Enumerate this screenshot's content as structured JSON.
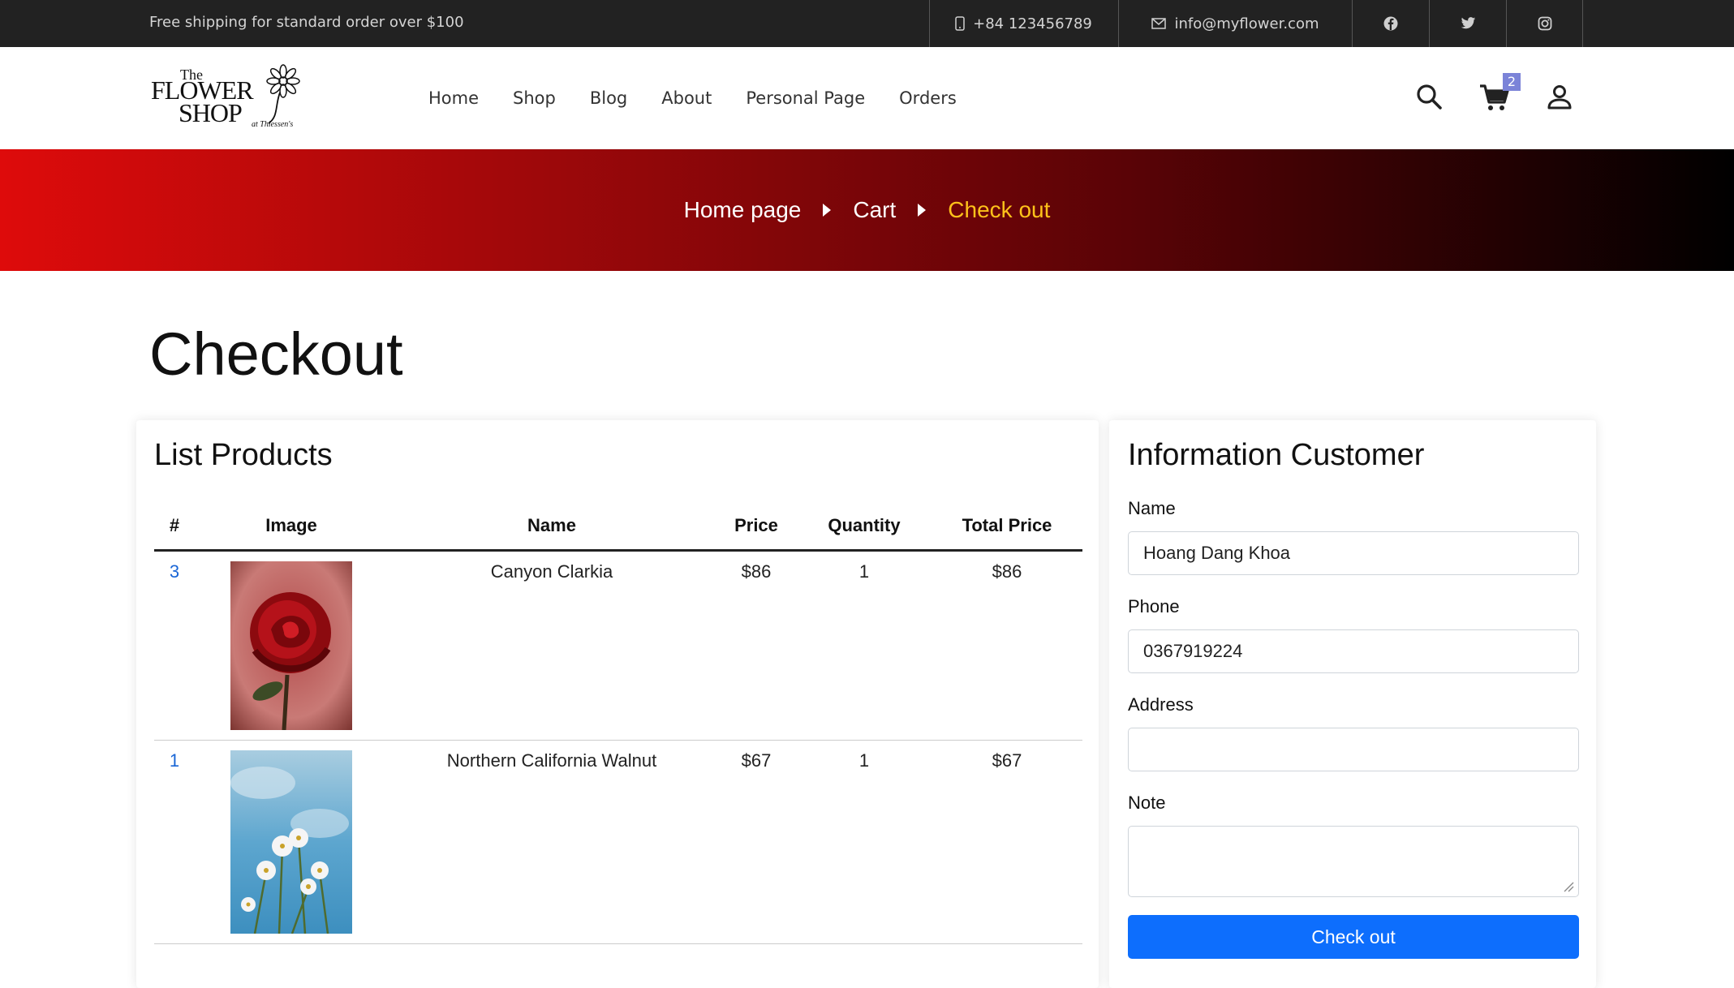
{
  "topbar": {
    "shipping_text": "Free shipping for standard order over $100",
    "phone": "+84 123456789",
    "email": "info@myflower.com",
    "social": [
      "facebook-icon",
      "twitter-icon",
      "instagram-icon"
    ]
  },
  "logo": {
    "line1": "The",
    "line2": "FLOWER",
    "line3": "SHOP",
    "tagline": "at Thiessen's"
  },
  "nav": {
    "items": [
      "Home",
      "Shop",
      "Blog",
      "About",
      "Personal Page",
      "Orders"
    ],
    "cart_count": "2"
  },
  "breadcrumb": {
    "items": [
      "Home page",
      "Cart",
      "Check out"
    ],
    "active_color": "#ffc21a"
  },
  "page": {
    "title": "Checkout"
  },
  "products": {
    "heading": "List Products",
    "columns": [
      "#",
      "Image",
      "Name",
      "Price",
      "Quantity",
      "Total Price"
    ],
    "rows": [
      {
        "id": "3",
        "image": "red-rose-image",
        "name": "Canyon Clarkia",
        "price": "$86",
        "quantity": "1",
        "total": "$86"
      },
      {
        "id": "1",
        "image": "white-cosmos-image",
        "name": "Northern California Walnut",
        "price": "$67",
        "quantity": "1",
        "total": "$67"
      }
    ]
  },
  "customer": {
    "heading": "Information Customer",
    "name_label": "Name",
    "name_value": "Hoang Dang Khoa",
    "phone_label": "Phone",
    "phone_value": "0367919224",
    "address_label": "Address",
    "address_value": "",
    "note_label": "Note",
    "note_value": "",
    "submit_label": "Check out",
    "submit_color": "#0d6efd"
  }
}
